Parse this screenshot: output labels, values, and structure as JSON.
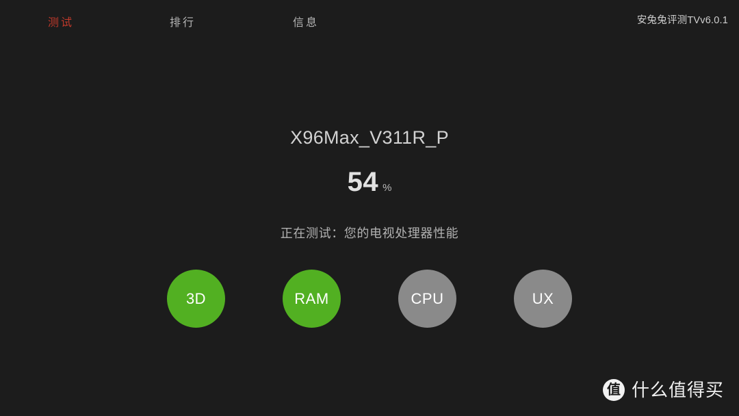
{
  "app": {
    "background_color": "#1c1c1c",
    "accent_color": "#c0392b",
    "done_color": "#52b022",
    "pending_color": "#8a8a8a",
    "version_label": "安兔兔评测TVv6.0.1"
  },
  "nav": {
    "tabs": [
      {
        "label": "测试",
        "active": true
      },
      {
        "label": "排行",
        "active": false
      },
      {
        "label": "信息",
        "active": false
      }
    ]
  },
  "test": {
    "device_name": "X96Max_V311R_P",
    "progress_value": "54",
    "progress_unit": "%",
    "status_text": "正在测试：您的电视处理器性能",
    "stages": [
      {
        "label": "3D",
        "state": "done"
      },
      {
        "label": "RAM",
        "state": "done"
      },
      {
        "label": "CPU",
        "state": "pending"
      },
      {
        "label": "UX",
        "state": "pending"
      }
    ]
  },
  "watermark": {
    "badge_glyph": "值",
    "text": "什么值得买"
  }
}
